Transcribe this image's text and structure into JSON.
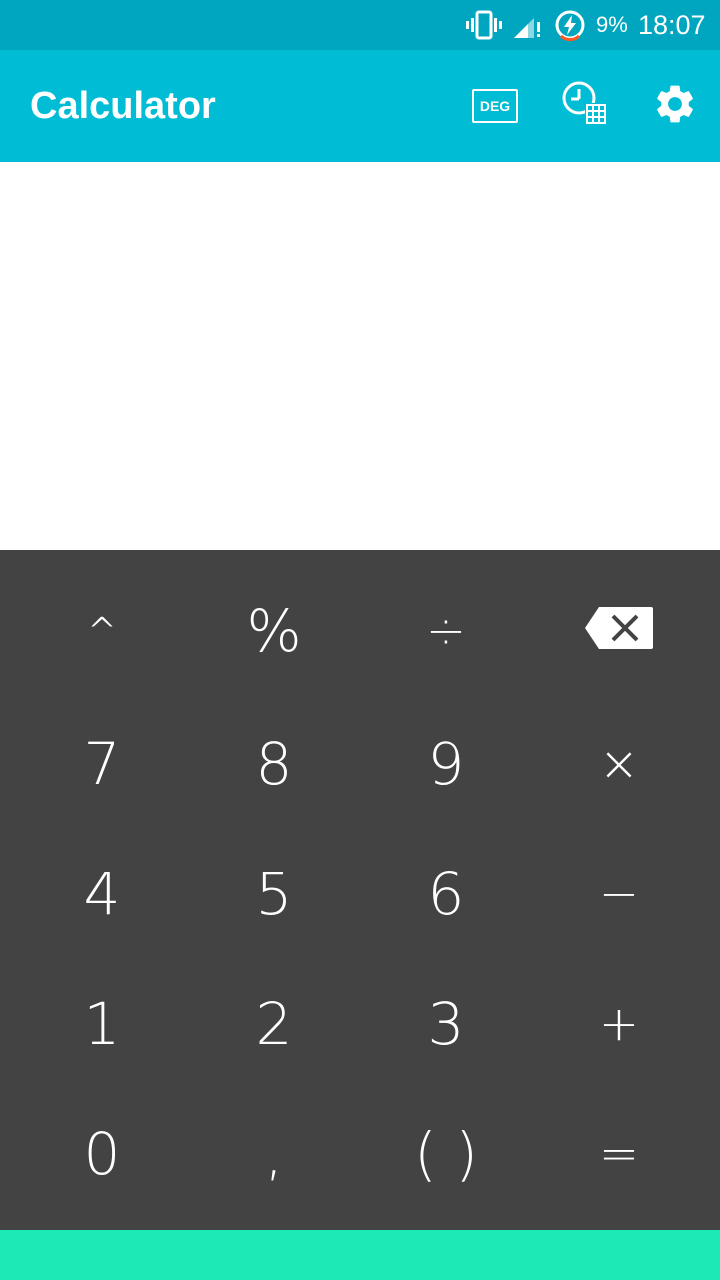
{
  "status_bar": {
    "battery_percent": "9%",
    "time": "18:07",
    "icons": [
      "vibrate-icon",
      "signal-icon",
      "battery-charging-icon"
    ]
  },
  "app_bar": {
    "title": "Calculator",
    "angle_mode": "DEG",
    "actions": [
      "deg-icon",
      "history-icon",
      "settings-icon"
    ]
  },
  "keypad": {
    "row1": [
      "^",
      "%",
      "÷",
      "backspace"
    ],
    "row2": [
      "7",
      "8",
      "9",
      "×"
    ],
    "row3": [
      "4",
      "5",
      "6",
      "−"
    ],
    "row4": [
      "1",
      "2",
      "3",
      "+"
    ],
    "row5": [
      "0",
      ",",
      "( )",
      "="
    ]
  },
  "colors": {
    "status_bar": "#00a6bf",
    "app_bar": "#00bcd4",
    "keypad": "#434343",
    "accent_bar": "#1de9b6"
  }
}
